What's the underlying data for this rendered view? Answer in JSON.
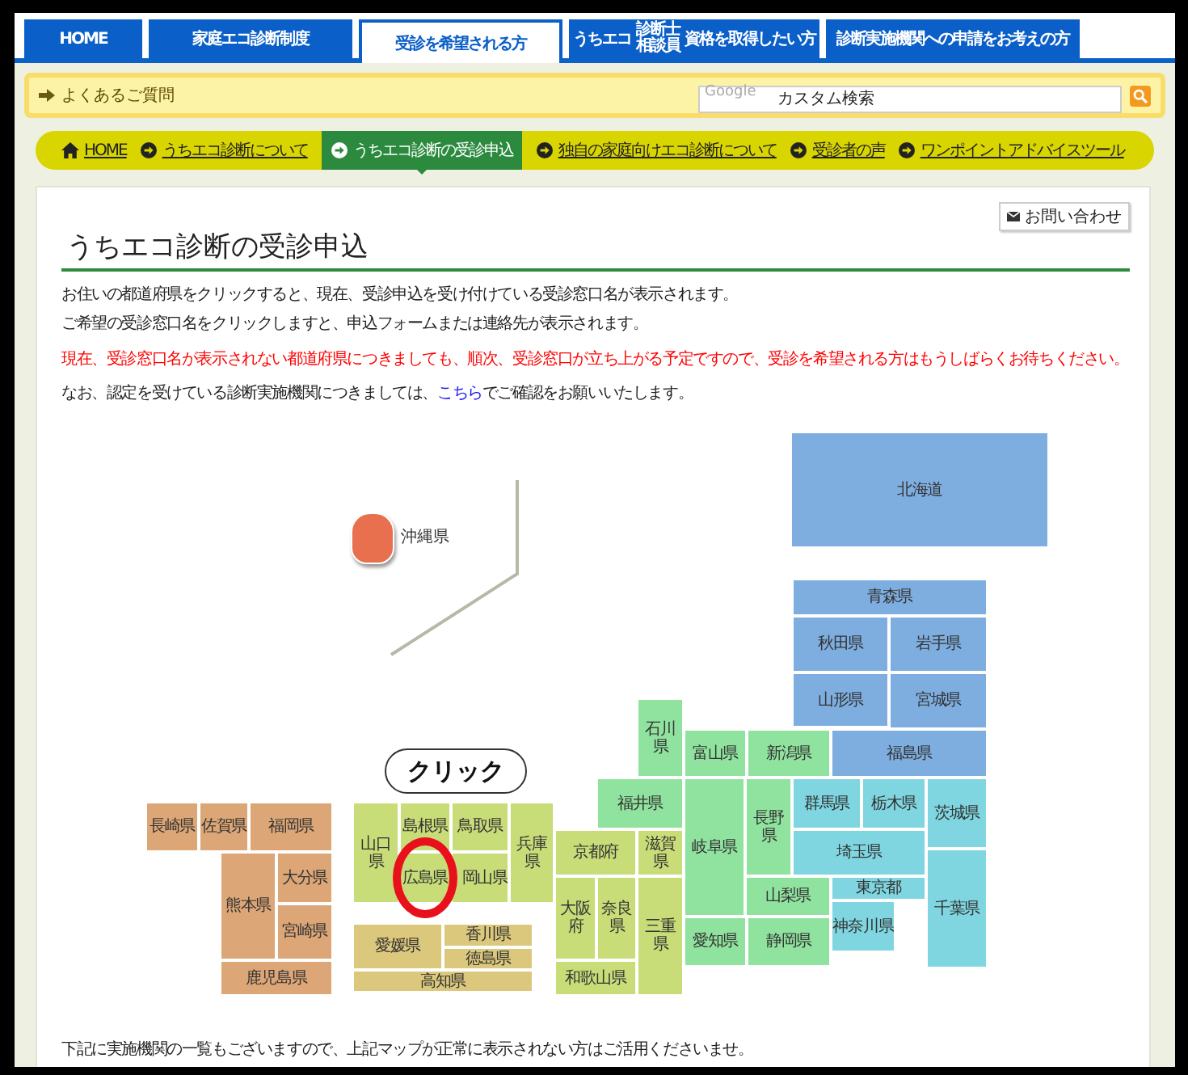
{
  "tabs": [
    {
      "label": "HOME",
      "selected": false
    },
    {
      "label": "家庭エコ診断制度",
      "selected": false
    },
    {
      "label": "受診を希望される方",
      "selected": true
    },
    {
      "label": "うちエコ",
      "stacked": [
        "診断士",
        "相談員"
      ],
      "label_after": "資格を取得したい方",
      "selected": false
    },
    {
      "label": "診断実施機関への申請をお考えの方",
      "selected": false
    }
  ],
  "top_bar": {
    "faq_link": "よくあるご質問",
    "search": {
      "logo": "Google",
      "placeholder": "カスタム検索"
    }
  },
  "sub_nav": [
    {
      "label": "HOME",
      "kind": "home",
      "selected": false
    },
    {
      "label": "うちエコ診断について",
      "kind": "link",
      "selected": false
    },
    {
      "label": "うちエコ診断の受診申込",
      "kind": "link",
      "selected": true
    },
    {
      "label": "独自の家庭向けエコ診断について",
      "kind": "link",
      "selected": false
    },
    {
      "label": "受診者の声",
      "kind": "link",
      "selected": false
    },
    {
      "label": "ワンポイントアドバイスツール",
      "kind": "link",
      "selected": false
    }
  ],
  "contact_button": "お問い合わせ",
  "title": "うちエコ診断の受診申込",
  "paragraphs": [
    {
      "kind": "normal",
      "text": "お住いの都道府県をクリックすると、現在、受診申込を受け付けている受診窓口名が表示されます。"
    },
    {
      "kind": "normal",
      "text": "ご希望の受診窓口名をクリックしますと、申込フォームまたは連絡先が表示されます。"
    },
    {
      "kind": "notice",
      "text": "現在、受診窓口名が表示されない都道府県につきましても、順次、受診窓口が立ち上がる予定ですので、受診を希望される方はもうしばらくお待ちください。"
    },
    {
      "kind": "normal",
      "text": "なお、認定を受けている診断実施機関につきましては、",
      "link": "こちら",
      "text_after": "でご確認をお願いいたします。"
    }
  ],
  "map": {
    "regions": [
      {
        "kind": "block",
        "color": "#dca676",
        "prefectures": [
          {
            "name": "長崎県",
            "selected": false
          },
          {
            "name": "佐賀県",
            "selected": false
          },
          {
            "name": "福岡県",
            "selected": false
          },
          {
            "name": "熊本県",
            "selected": false
          },
          {
            "name": "大分県",
            "selected": false
          },
          {
            "name": "宮崎県",
            "selected": false
          },
          {
            "name": "鹿児島県",
            "selected": false
          }
        ]
      },
      {
        "kind": "island",
        "color": "#e8704f",
        "prefectures": [
          {
            "name": "沖縄県",
            "selected": false
          }
        ]
      },
      {
        "kind": "block",
        "color": "#c8dc78",
        "prefectures": [
          {
            "name": "山口県",
            "selected": false
          },
          {
            "name": "島根県",
            "selected": false
          },
          {
            "name": "鳥取県",
            "selected": false
          },
          {
            "name": "兵庫県",
            "selected": false
          },
          {
            "name": "京都府",
            "selected": false
          },
          {
            "name": "滋賀県",
            "selected": false
          },
          {
            "name": "広島県",
            "selected": true
          },
          {
            "name": "岡山県",
            "selected": false
          },
          {
            "name": "大阪府",
            "selected": false
          },
          {
            "name": "奈良県",
            "selected": false
          },
          {
            "name": "三重県",
            "selected": false
          },
          {
            "name": "和歌山県",
            "selected": false
          }
        ]
      },
      {
        "kind": "block",
        "color": "#dcc87c",
        "prefectures": [
          {
            "name": "愛媛県",
            "selected": false
          },
          {
            "name": "香川県",
            "selected": false
          },
          {
            "name": "徳島県",
            "selected": false
          },
          {
            "name": "高知県",
            "selected": false
          }
        ]
      },
      {
        "kind": "block",
        "color": "#90e39e",
        "prefectures": [
          {
            "name": "石川県",
            "selected": false
          },
          {
            "name": "富山県",
            "selected": false
          },
          {
            "name": "新潟県",
            "selected": false
          },
          {
            "name": "福井県",
            "selected": false
          },
          {
            "name": "岐阜県",
            "selected": false
          },
          {
            "name": "長野県",
            "selected": false
          },
          {
            "name": "山梨県",
            "selected": false
          },
          {
            "name": "愛知県",
            "selected": false
          },
          {
            "name": "静岡県",
            "selected": false
          }
        ]
      },
      {
        "kind": "block",
        "color": "#7eaee0",
        "prefectures": [
          {
            "name": "北海道",
            "selected": false
          },
          {
            "name": "青森県",
            "selected": false
          },
          {
            "name": "秋田県",
            "selected": false
          },
          {
            "name": "岩手県",
            "selected": false
          },
          {
            "name": "山形県",
            "selected": false
          },
          {
            "name": "宮城県",
            "selected": false
          },
          {
            "name": "福島県",
            "selected": false
          }
        ]
      },
      {
        "kind": "block",
        "color": "#7fd6e0",
        "prefectures": [
          {
            "name": "群馬県",
            "selected": false
          },
          {
            "name": "栃木県",
            "selected": false
          },
          {
            "name": "茨城県",
            "selected": false
          },
          {
            "name": "埼玉県",
            "selected": false
          },
          {
            "name": "千葉県",
            "selected": false
          },
          {
            "name": "東京都",
            "selected": false
          },
          {
            "name": "神奈川県",
            "selected": false
          }
        ]
      }
    ],
    "callout": "クリック"
  },
  "footer_note": "下記に実施機関の一覧もございますので、上記マップが正常に表示されない方はご活用くださいませ。"
}
